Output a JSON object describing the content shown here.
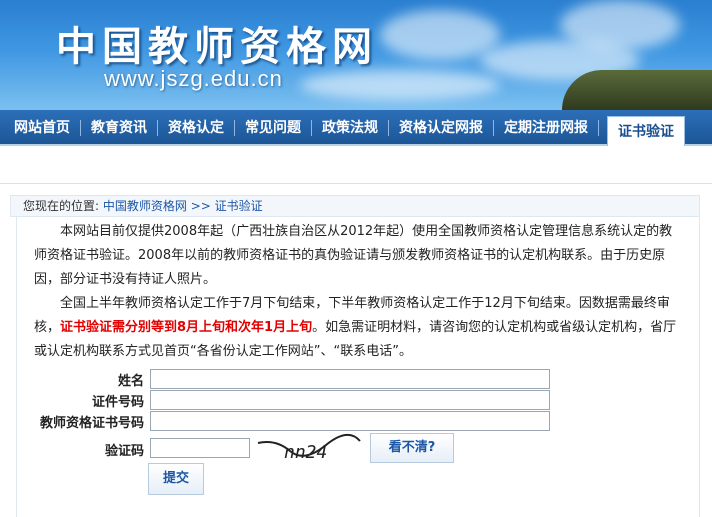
{
  "header": {
    "site_title": "中国教师资格网",
    "site_url": "www.jszg.edu.cn"
  },
  "nav": {
    "items": [
      {
        "label": "网站首页"
      },
      {
        "label": "教育资讯"
      },
      {
        "label": "资格认定"
      },
      {
        "label": "常见问题"
      },
      {
        "label": "政策法规"
      },
      {
        "label": "资格认定网报"
      },
      {
        "label": "定期注册网报"
      },
      {
        "label": "证书验证",
        "active": true
      }
    ]
  },
  "breadcrumb": {
    "prefix": "您现在的位置:",
    "home": "中国教师资格网",
    "sep": " >> ",
    "current": "证书验证"
  },
  "notice": {
    "p1": "本网站目前仅提供2008年起（广西壮族自治区从2012年起）使用全国教师资格认定管理信息系统认定的教师资格证书验证。2008年以前的教师资格证书的真伪验证请与颁发教师资格证书的认定机构联系。由于历史原因，部分证书没有持证人照片。",
    "p2_before": "全国上半年教师资格认定工作于7月下旬结束，下半年教师资格认定工作于12月下旬结束。因数据需最终审核，",
    "p2_red": "证书验证需分别等到8月上旬和次年1月上旬",
    "p2_after": "。如急需证明材料，请咨询您的认定机构或省级认定机构，省厅或认定机构联系方式见首页“各省份认定工作网站”、“联系电话”。"
  },
  "form": {
    "name_label": "姓名",
    "id_label": "证件号码",
    "cert_label": "教师资格证书号码",
    "code_label": "验证码",
    "name_value": "",
    "id_value": "",
    "cert_value": "",
    "code_value": "",
    "captcha_text": "nn24",
    "unclear_button": "看不清?",
    "submit_button": "提交"
  }
}
